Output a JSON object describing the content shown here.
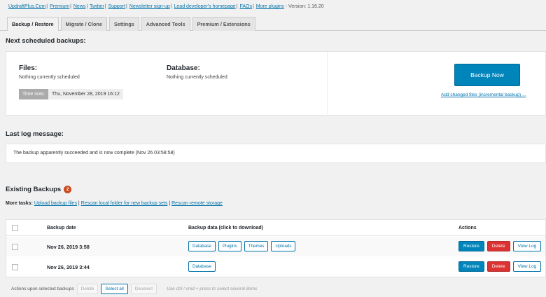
{
  "toplinks": [
    "UpdraftPlus.Com",
    "Premium",
    "News",
    "Twitter",
    "Support",
    "Newsletter sign-up",
    "Lead developer's homepage",
    "FAQs",
    "More plugins"
  ],
  "version": "- Version: 1.16.20",
  "tabs": [
    "Backup / Restore",
    "Migrate / Clone",
    "Settings",
    "Advanced Tools",
    "Premium / Extensions"
  ],
  "scheduled": {
    "title": "Next scheduled backups:",
    "files_label": "Files:",
    "files_text": "Nothing currently scheduled",
    "db_label": "Database:",
    "db_text": "Nothing currently scheduled",
    "time_label": "Time now:",
    "time_value": "Thu, November 28, 2019 16:12",
    "backup_now": "Backup Now",
    "incremental": "Add changed files (incremental backup) ..."
  },
  "log": {
    "title": "Last log message:",
    "message": "The backup apparently succeeded and is now complete (Nov 26 03:58:58)"
  },
  "existing": {
    "title": "Existing Backups",
    "count": "2",
    "more_tasks_label": "More tasks:",
    "more_tasks": [
      "Upload backup files",
      "Rescan local folder for new backup sets",
      "Rescan remote storage"
    ],
    "columns": [
      "Backup date",
      "Backup data (click to download)",
      "Actions"
    ],
    "rows": [
      {
        "date": "Nov 26, 2019 3:58",
        "data": [
          "Database",
          "Plugins",
          "Themes",
          "Uploads"
        ]
      },
      {
        "date": "Nov 26, 2019 3:44",
        "data": [
          "Database"
        ]
      }
    ],
    "actions": {
      "restore": "Restore",
      "delete": "Delete",
      "view_log": "View Log"
    }
  },
  "bottom": {
    "label": "Actions upon selected backups",
    "delete": "Delete",
    "select_all": "Select all",
    "deselect": "Deselect",
    "hint": "Use ctrl / cmd + press to select several items"
  },
  "colors": {
    "accent": "#0085ba",
    "danger": "#dc3232",
    "badge": "#ca4a1f"
  }
}
